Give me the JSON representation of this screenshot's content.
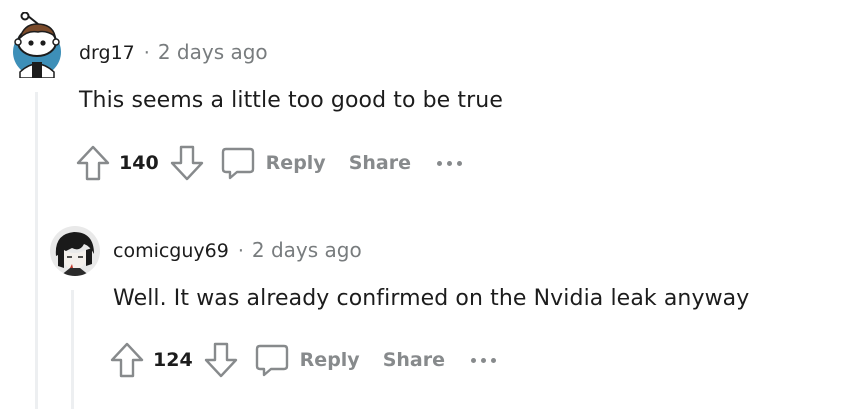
{
  "comments": [
    {
      "avatar_icon": "snoo-avatar-icon",
      "username": "drg17",
      "separator": "·",
      "timestamp": "2 days ago",
      "body": "This seems a little too good to be true",
      "score": "140",
      "reply_label": "Reply",
      "share_label": "Share"
    },
    {
      "avatar_icon": "anime-avatar-icon",
      "username": "comicguy69",
      "separator": "·",
      "timestamp": "2 days ago",
      "body": "Well. It was already confirmed on the Nvidia leak anyway",
      "score": "124",
      "reply_label": "Reply",
      "share_label": "Share"
    }
  ],
  "colors": {
    "text": "#1c1c1c",
    "meta": "#787c7e",
    "action": "#878a8c",
    "thread_line": "#edeff1"
  }
}
